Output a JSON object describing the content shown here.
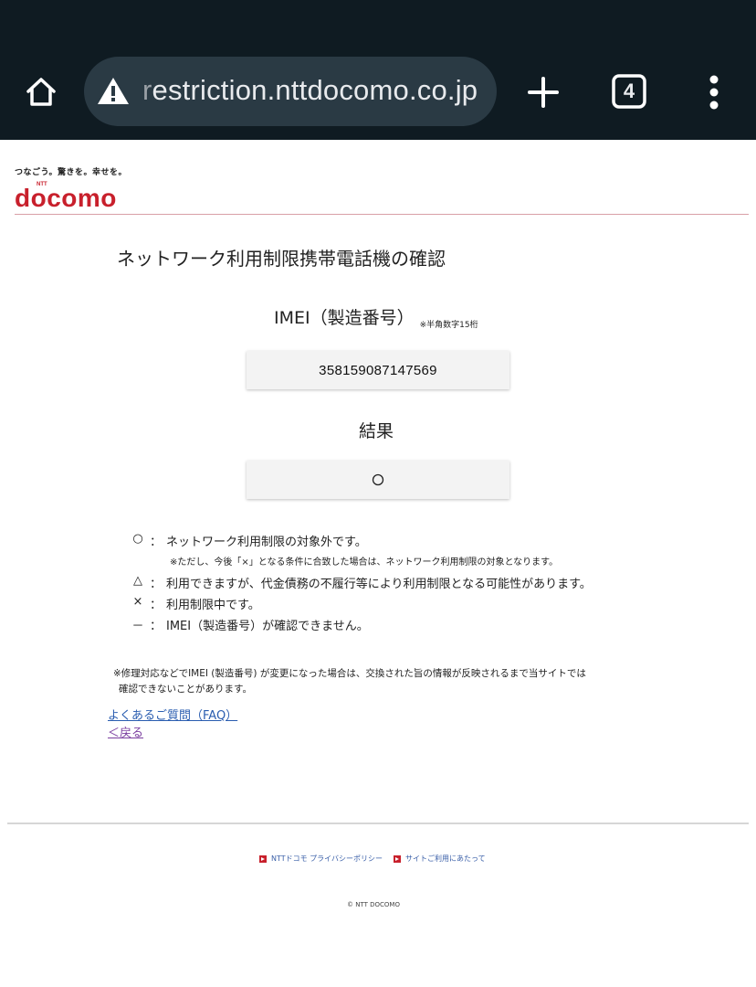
{
  "browser": {
    "url_prefix": "r",
    "url_rest": "estriction.nttdocomo.co.jp",
    "tab_count": "4"
  },
  "brand": {
    "tagline": "つなごう。驚きを。幸せを。",
    "logo_small": "NTT",
    "logo_text": "docomo",
    "accent_color": "#c8202c"
  },
  "page": {
    "title": "ネットワーク利用制限携帯電話機の確認",
    "imei_label": "IMEI（製造番号）",
    "imei_note": "※半角数字15桁",
    "imei_value": "358159087147569",
    "result_label": "結果",
    "result_value": "○"
  },
  "legend": [
    {
      "symbol": "○",
      "colon": "：",
      "text": "ネットワーク利用制限の対象外です。"
    },
    {
      "symbol": "△",
      "colon": "：",
      "text": "利用できますが、代金債務の不履行等により利用制限となる可能性があります。"
    },
    {
      "symbol": "×",
      "colon": "：",
      "text": "利用制限中です。"
    },
    {
      "symbol": "－",
      "colon": "：",
      "text": "IMEI（製造番号）が確認できません。"
    }
  ],
  "legend_sub_note": "※ただし、今後「×」となる条件に合致した場合は、ネットワーク利用制限の対象となります。",
  "footnote": {
    "line1": "※修理対応などでIMEI (製造番号) が変更になった場合は、交換された旨の情報が反映されるまで当サイトでは",
    "line2": "確認できないことがあります。"
  },
  "links": {
    "faq": "よくあるご質問（FAQ）",
    "back": "＜戻る"
  },
  "footer": {
    "privacy": "NTTドコモ プライバシーポリシー",
    "site_usage": "サイトご利用にあたって",
    "copyright": "© NTT DOCOMO"
  }
}
